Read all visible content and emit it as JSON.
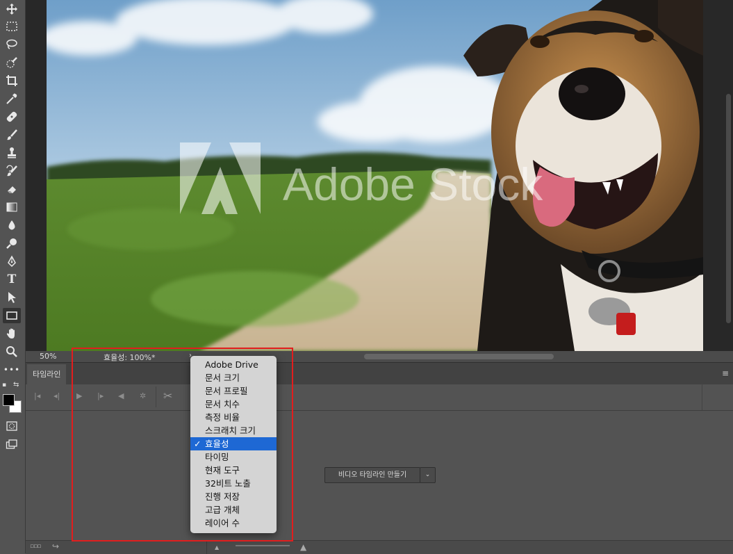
{
  "status_bar": {
    "zoom": "50%",
    "doc_info": "효율성: 100%*",
    "arrow": "›"
  },
  "watermark": "Adobe Stock",
  "timeline": {
    "tab_label": "타임라인",
    "create_button_label": "비디오 타임라인 만들기",
    "dropdown_glyph": "⌄"
  },
  "status_menu": {
    "items": [
      {
        "label": "Adobe Drive",
        "checked": false
      },
      {
        "label": "문서 크기",
        "checked": false
      },
      {
        "label": "문서 프로필",
        "checked": false
      },
      {
        "label": "문서 치수",
        "checked": false
      },
      {
        "label": "측정 비율",
        "checked": false
      },
      {
        "label": "스크래치 크기",
        "checked": false
      },
      {
        "label": "효율성",
        "checked": true
      },
      {
        "label": "타이밍",
        "checked": false
      },
      {
        "label": "현재 도구",
        "checked": false
      },
      {
        "label": "32비트 노출",
        "checked": false
      },
      {
        "label": "진행 저장",
        "checked": false
      },
      {
        "label": "고급 개체",
        "checked": false
      },
      {
        "label": "레이어 수",
        "checked": false
      }
    ],
    "check_glyph": "✓"
  },
  "tools": [
    {
      "name": "move-tool",
      "glyph": "✥"
    },
    {
      "name": "marquee-tool",
      "glyph": "⬚"
    },
    {
      "name": "lasso-tool",
      "glyph": "ↄ"
    },
    {
      "name": "quick-select-tool",
      "glyph": "✎"
    },
    {
      "name": "crop-tool",
      "glyph": "⌗"
    },
    {
      "name": "eyedropper-tool",
      "glyph": "⟋"
    },
    {
      "name": "healing-brush-tool",
      "glyph": "⊕"
    },
    {
      "name": "brush-tool",
      "glyph": "✐"
    },
    {
      "name": "clone-stamp-tool",
      "glyph": "⊥"
    },
    {
      "name": "history-brush-tool",
      "glyph": "↺"
    },
    {
      "name": "eraser-tool",
      "glyph": "◆"
    },
    {
      "name": "gradient-tool",
      "glyph": "▭"
    },
    {
      "name": "blur-tool",
      "glyph": "●"
    },
    {
      "name": "dodge-tool",
      "glyph": "⚲"
    },
    {
      "name": "pen-tool",
      "glyph": "✒"
    },
    {
      "name": "type-tool",
      "glyph": "T"
    },
    {
      "name": "path-select-tool",
      "glyph": "➤"
    },
    {
      "name": "rectangle-tool",
      "glyph": "▭"
    },
    {
      "name": "hand-tool",
      "glyph": "✋"
    },
    {
      "name": "zoom-tool",
      "glyph": "⌕"
    },
    {
      "name": "more-tools",
      "glyph": "•••"
    }
  ],
  "colors": {
    "foreground": "#000000",
    "background": "#ffffff",
    "selection_highlight": "#1e68d4",
    "annotation_box": "#e21d1d"
  }
}
